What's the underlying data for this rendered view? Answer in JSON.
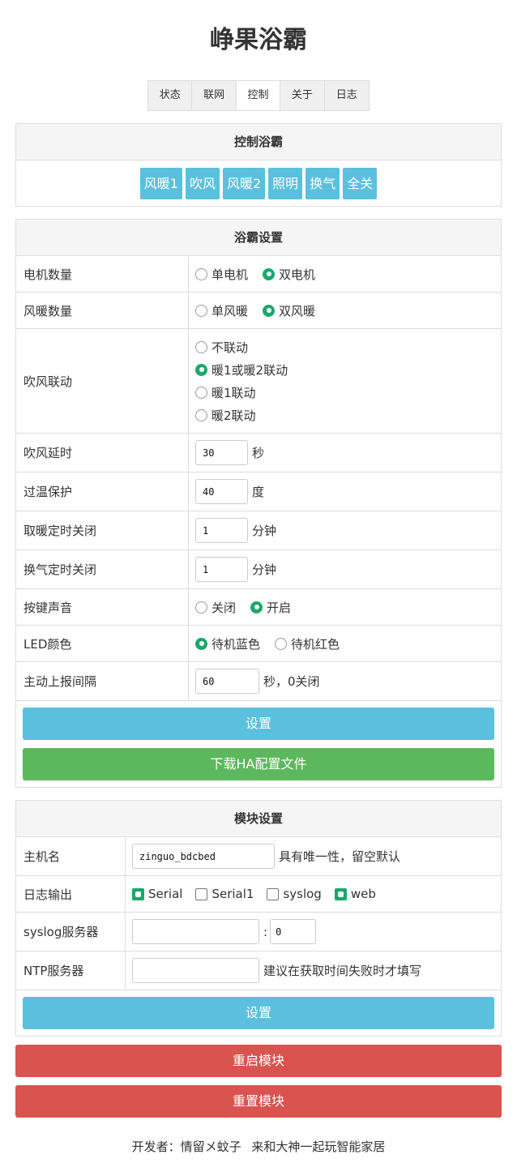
{
  "title": "峥果浴霸",
  "tabs": [
    "状态",
    "联网",
    "控制",
    "关于",
    "日志"
  ],
  "control_panel": {
    "title": "控制浴霸",
    "buttons": [
      "风暖1",
      "吹风",
      "风暖2",
      "照明",
      "换气",
      "全关"
    ]
  },
  "settings_panel": {
    "title": "浴霸设置",
    "motor_count": {
      "label": "电机数量",
      "options": [
        "单电机",
        "双电机"
      ],
      "selected": 1
    },
    "heater_count": {
      "label": "风暖数量",
      "options": [
        "单风暖",
        "双风暖"
      ],
      "selected": 1
    },
    "fan_link": {
      "label": "吹风联动",
      "options": [
        "不联动",
        "暖1或暖2联动",
        "暖1联动",
        "暖2联动"
      ],
      "selected": 1
    },
    "fan_delay": {
      "label": "吹风延时",
      "value": "30",
      "unit": "秒"
    },
    "overheat": {
      "label": "过温保护",
      "value": "40",
      "unit": "度"
    },
    "heat_timer": {
      "label": "取暖定时关闭",
      "value": "1",
      "unit": "分钟"
    },
    "vent_timer": {
      "label": "换气定时关闭",
      "value": "1",
      "unit": "分钟"
    },
    "key_sound": {
      "label": "按键声音",
      "options": [
        "关闭",
        "开启"
      ],
      "selected": 1
    },
    "led_color": {
      "label": "LED颜色",
      "options": [
        "待机蓝色",
        "待机红色"
      ],
      "selected": 0
    },
    "report_interval": {
      "label": "主动上报间隔",
      "value": "60",
      "unit": "秒，0关闭"
    },
    "set_button": "设置",
    "download_button": "下载HA配置文件"
  },
  "module_panel": {
    "title": "模块设置",
    "hostname": {
      "label": "主机名",
      "value": "zinguo_bdcbed",
      "hint": "具有唯一性，留空默认"
    },
    "log_output": {
      "label": "日志输出",
      "options": [
        "Serial",
        "Serial1",
        "syslog",
        "web"
      ],
      "checked": [
        true,
        false,
        false,
        true
      ]
    },
    "syslog_server": {
      "label": "syslog服务器",
      "value": "",
      "separator": ":",
      "port": "0"
    },
    "ntp_server": {
      "label": "NTP服务器",
      "value": "",
      "hint": "建议在获取时间失败时才填写"
    },
    "set_button": "设置"
  },
  "restart_button": "重启模块",
  "reset_button": "重置模块",
  "footer": {
    "developer_label": "开发者：",
    "developer": "情留メ蚊子",
    "slogan": "来和大神一起玩智能家居"
  },
  "colors": {
    "info": "#5bc0de",
    "success": "#5cb85c",
    "danger": "#d9534f",
    "checked": "#1aa86b"
  }
}
